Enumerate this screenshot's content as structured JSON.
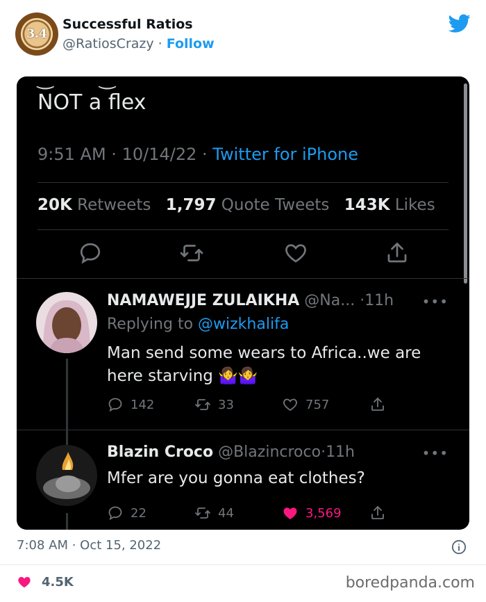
{
  "embed": {
    "author_name": "Successful Ratios",
    "author_handle": "@RatiosCrazy",
    "dot": "·",
    "follow_label": "Follow",
    "avatar_text": "3.4"
  },
  "screenshot": {
    "tweet_text": "NOT a flex",
    "time": "9:51 AM",
    "date": "10/14/22",
    "source": "Twitter for iPhone",
    "dot": "·",
    "stats": {
      "retweets_value": "20K",
      "retweets_label": "Retweets",
      "quotes_value": "1,797",
      "quotes_label": "Quote Tweets",
      "likes_value": "143K",
      "likes_label": "Likes"
    },
    "replies": [
      {
        "name": "NAMAWEJJE ZULAIKHA",
        "handle": "@Na...",
        "time": "11h",
        "replying_prefix": "Replying to",
        "replying_to": "@wizkhalifa",
        "text": "Man send some wears  to Africa..we are here starving 🤷‍♀️🤷‍♀️",
        "reply_count": "142",
        "retweet_count": "33",
        "like_count": "757"
      },
      {
        "name": "Blazin Croco",
        "handle": "@Blazincroco",
        "time": "11h",
        "text": "Mfer are you gonna eat clothes?",
        "reply_count": "22",
        "retweet_count": "44",
        "like_count": "3,569"
      }
    ]
  },
  "footer": {
    "timestamp": "7:08 AM · Oct 15, 2022",
    "likes": "4.5K",
    "watermark": "boredpanda.com"
  },
  "colors": {
    "accent": "#1d9bf0",
    "like_pink": "#f91880",
    "dark_bg": "#000000"
  }
}
